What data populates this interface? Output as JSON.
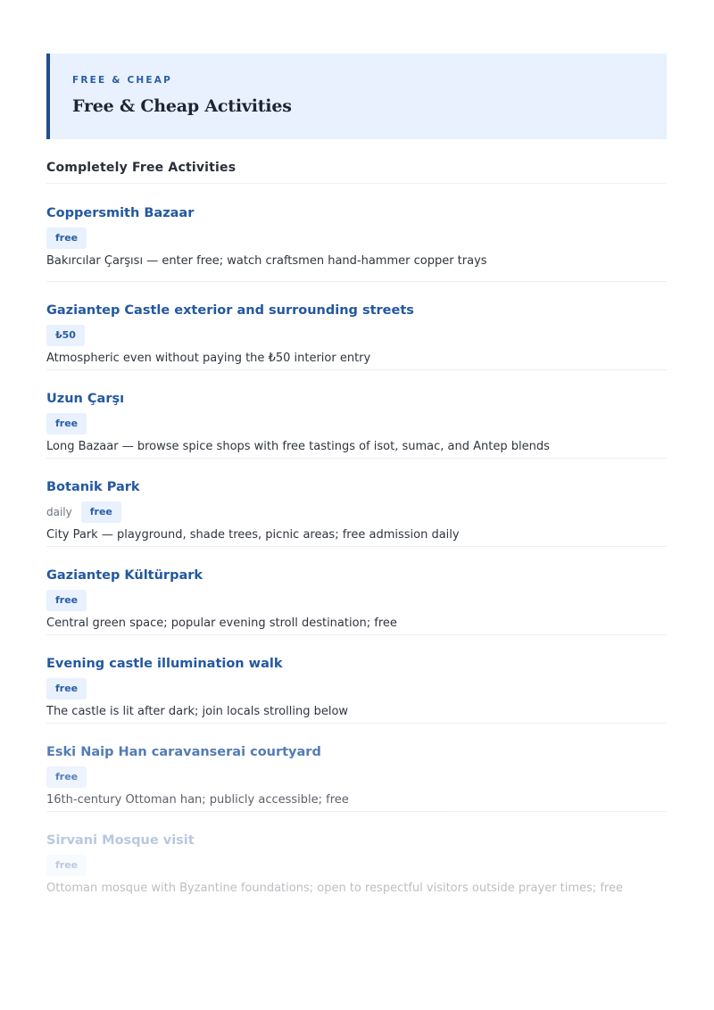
{
  "header": {
    "eyebrow": "FREE & CHEAP",
    "title": "Free & Cheap Activities"
  },
  "section": {
    "heading": "Completely Free Activities"
  },
  "activities": [
    {
      "name": "Coppersmith Bazaar",
      "meta": "",
      "badge": "free",
      "description": "Bakırcılar Çarşısı — enter free; watch craftsmen hand-hammer copper trays"
    },
    {
      "name": "Gaziantep Castle exterior and surrounding streets",
      "meta": "",
      "badge": "₺50",
      "description": "Atmospheric even without paying the ₺50 interior entry"
    },
    {
      "name": "Uzun Çarşı",
      "meta": "",
      "badge": "free",
      "description": "Long Bazaar — browse spice shops with free tastings of isot, sumac, and Antep blends"
    },
    {
      "name": "Botanik Park",
      "meta": "daily",
      "badge": "free",
      "description": "City Park — playground, shade trees, picnic areas; free admission daily"
    },
    {
      "name": "Gaziantep Kültürpark",
      "meta": "",
      "badge": "free",
      "description": "Central green space; popular evening stroll destination; free"
    },
    {
      "name": "Evening castle illumination walk",
      "meta": "",
      "badge": "free",
      "description": "The castle is lit after dark; join locals strolling below"
    },
    {
      "name": "Eski Naip Han caravanserai courtyard",
      "meta": "",
      "badge": "free",
      "description": "16th-century Ottoman han; publicly accessible; free"
    },
    {
      "name": "Sirvani Mosque visit",
      "meta": "",
      "badge": "free",
      "description": "Ottoman mosque with Byzantine foundations; open to respectful visitors outside prayer times; free"
    }
  ]
}
